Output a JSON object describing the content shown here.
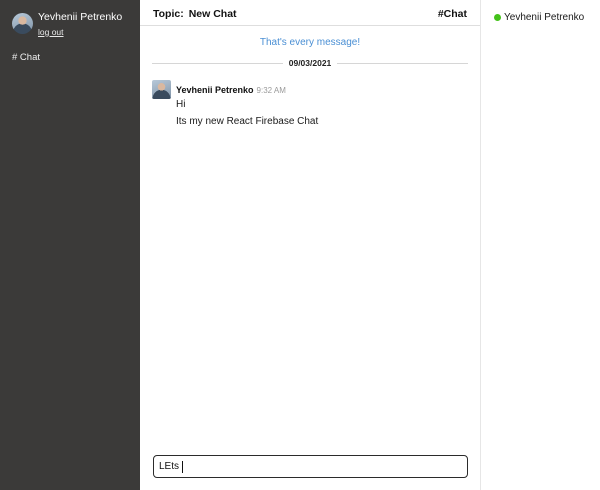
{
  "sidebar": {
    "user": {
      "name": "Yevhenii Petrenko",
      "logout_label": "log out"
    },
    "channels": [
      {
        "label": "# Chat"
      }
    ]
  },
  "header": {
    "topic_prefix": "Topic:",
    "topic": "New Chat",
    "channel": "#Chat"
  },
  "chat": {
    "history_notice": "That's every message!",
    "date": "09/03/2021",
    "messages": [
      {
        "author": "Yevhenii Petrenko",
        "time": "9:32 AM",
        "lines": [
          "Hi",
          "Its my new React Firebase Chat"
        ]
      }
    ],
    "composer": {
      "value": "LEts"
    }
  },
  "members": [
    {
      "name": "Yevhenii Petrenko",
      "status": "online"
    }
  ],
  "colors": {
    "sidebar_bg": "#3b3a39",
    "link_blue": "#4a8fd4",
    "online_green": "#44c21a"
  }
}
